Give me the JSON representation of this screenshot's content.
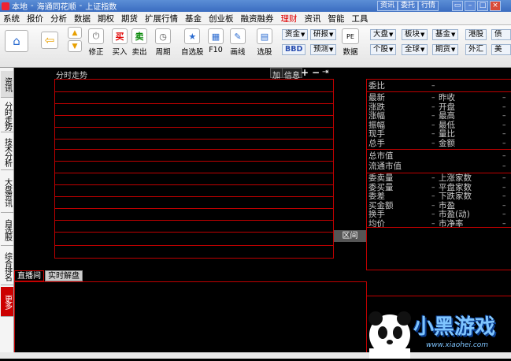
{
  "titlebar": {
    "segments": [
      "本地",
      "海通同花顺",
      "上证指数"
    ],
    "buttons": [
      "资讯",
      "委托",
      "行情"
    ]
  },
  "menu": [
    "系统",
    "报价",
    "分析",
    "数据",
    "期权",
    "期货",
    "扩展行情",
    "基金",
    "创业板",
    "融资融券",
    "理财",
    "资讯",
    "智能",
    "工具"
  ],
  "toolbar": {
    "fix": "修正",
    "buy": "买入",
    "sell": "卖出",
    "period": "周期",
    "selfselect": "自选股",
    "f10": "F10",
    "drawline": "画线",
    "pickstock": "选股",
    "data": "数据",
    "fund": "资金",
    "bbd": "BBD",
    "research": "研报",
    "forecast": "预测",
    "pe": "PE",
    "market": "大盘",
    "individual": "个股",
    "sector": "板块",
    "global": "全球",
    "fundx": "基金",
    "futures": "期货",
    "hk": "港股",
    "forex": "外汇",
    "bonds": "债券",
    "us": "美股",
    "buy_glyph": "买",
    "sell_glyph": "卖"
  },
  "sidebar_tabs": [
    "资讯",
    "分时走势",
    "技术分析",
    "大盘资讯",
    "自选股",
    "综合排名",
    "更多"
  ],
  "chart": {
    "title": "分时走势",
    "add": "加",
    "info": "信息"
  },
  "quote": {
    "ratio": "委比",
    "dash": "–",
    "left": [
      "最新",
      "涨跌",
      "涨幅",
      "振幅",
      "现手",
      "总手"
    ],
    "right": [
      "昨收",
      "开盘",
      "最高",
      "最低",
      "量比",
      "金额"
    ],
    "mcap": [
      "总市值",
      "流通市值"
    ],
    "left2": [
      "委卖量",
      "委买量",
      "委差",
      "买金额",
      "换手",
      "均价"
    ],
    "right2": [
      "上涨家数",
      "平盘家数",
      "下跌家数",
      "市盈",
      "市盈(动)",
      "市净率"
    ]
  },
  "interval_btn": "区间",
  "bottom_tabs": [
    "直播间",
    "实时解盘"
  ],
  "watermark": {
    "brand": "小黑游戏",
    "url": "www.xiaohei.com"
  },
  "colors": {
    "grid": "#c00000",
    "active_menu": "#e00000"
  }
}
